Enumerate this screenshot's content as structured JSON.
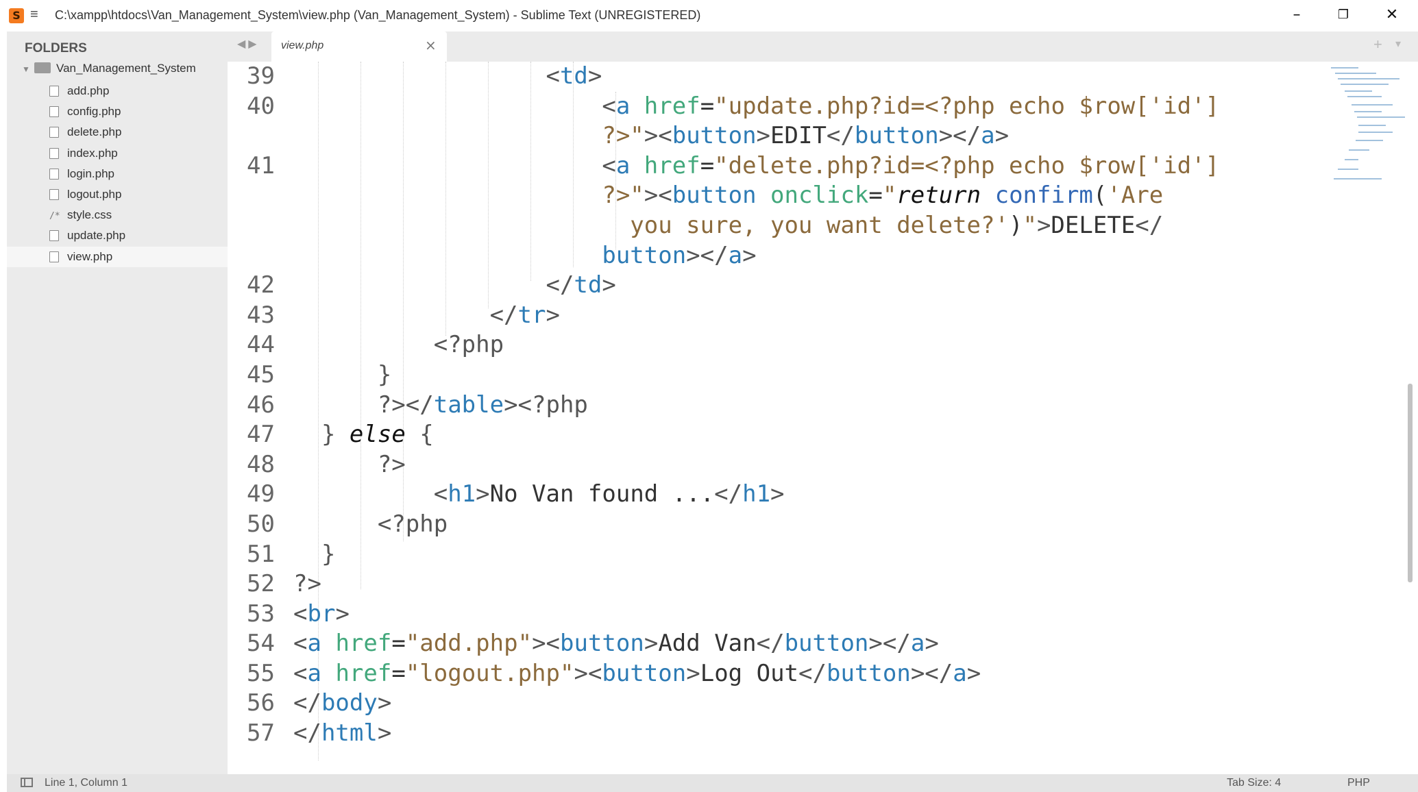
{
  "window": {
    "title": "C:\\xampp\\htdocs\\Van_Management_System\\view.php (Van_Management_System) - Sublime Text (UNREGISTERED)",
    "minimize": "–",
    "maximize": "❐",
    "close": "✕"
  },
  "sidebar": {
    "heading": "FOLDERS",
    "root_folder": "Van_Management_System",
    "files": [
      "add.php",
      "config.php",
      "delete.php",
      "index.php",
      "login.php",
      "logout.php",
      "style.css",
      "update.php",
      "view.php"
    ],
    "active_file": "view.php"
  },
  "tabs": {
    "active_label": "view.php",
    "close_glyph": "×",
    "new_tab": "+",
    "menu": "▾"
  },
  "statusbar": {
    "position": "Line 1, Column 1",
    "tab_size": "Tab Size: 4",
    "syntax": "PHP"
  },
  "editor": {
    "line_numbers": [
      "39",
      "40",
      "",
      "41",
      "",
      "",
      "",
      "42",
      "43",
      "44",
      "45",
      "46",
      "47",
      "48",
      "49",
      "50",
      "51",
      "52",
      "53",
      "54",
      "55",
      "56",
      "57"
    ],
    "colors": {
      "tag": "#2d7bb5",
      "attribute": "#43a87c",
      "string": "#8b6a3c",
      "keyword": "#111111",
      "function": "#3368b5"
    }
  }
}
